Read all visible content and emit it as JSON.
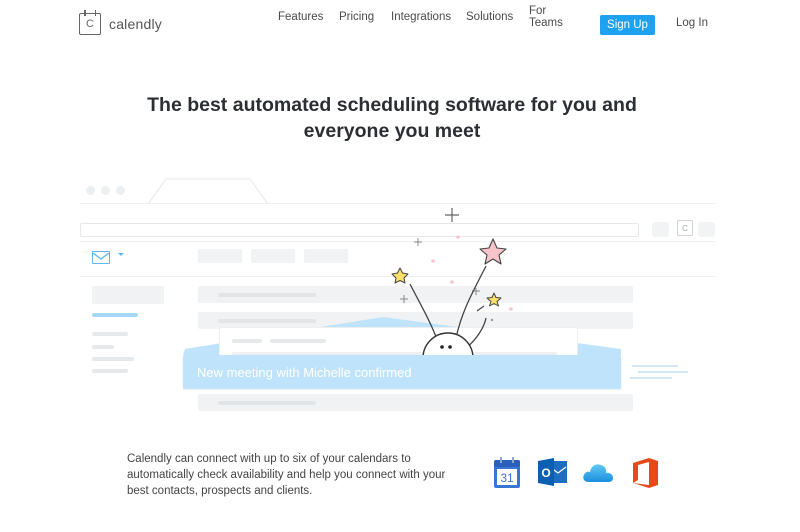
{
  "nav": {
    "logo_mark": "C",
    "logo_text": "calendly",
    "links": [
      "Features",
      "Pricing",
      "Integrations",
      "Solutions",
      "For Teams"
    ],
    "signup_label": "Sign Up",
    "login_label": "Log In"
  },
  "hero": {
    "headline_line1": "The best automated scheduling software for you and",
    "headline_line2": "everyone you meet"
  },
  "illustration": {
    "calendar_button_mark": "C",
    "notification_text": "New meeting with Michelle confirmed"
  },
  "integrations": {
    "description": "Calendly can connect with up to six of your calendars to automatically check availability and help you connect with your best contacts, prospects and clients.",
    "google_calendar_day": "31",
    "outlook_letter": "O",
    "icons": [
      "google-calendar-icon",
      "outlook-icon",
      "icloud-icon",
      "office365-icon"
    ]
  },
  "colors": {
    "accent": "#1ea1f1",
    "notification_bg": "#bfe3fb",
    "headline": "#2b2f33"
  }
}
